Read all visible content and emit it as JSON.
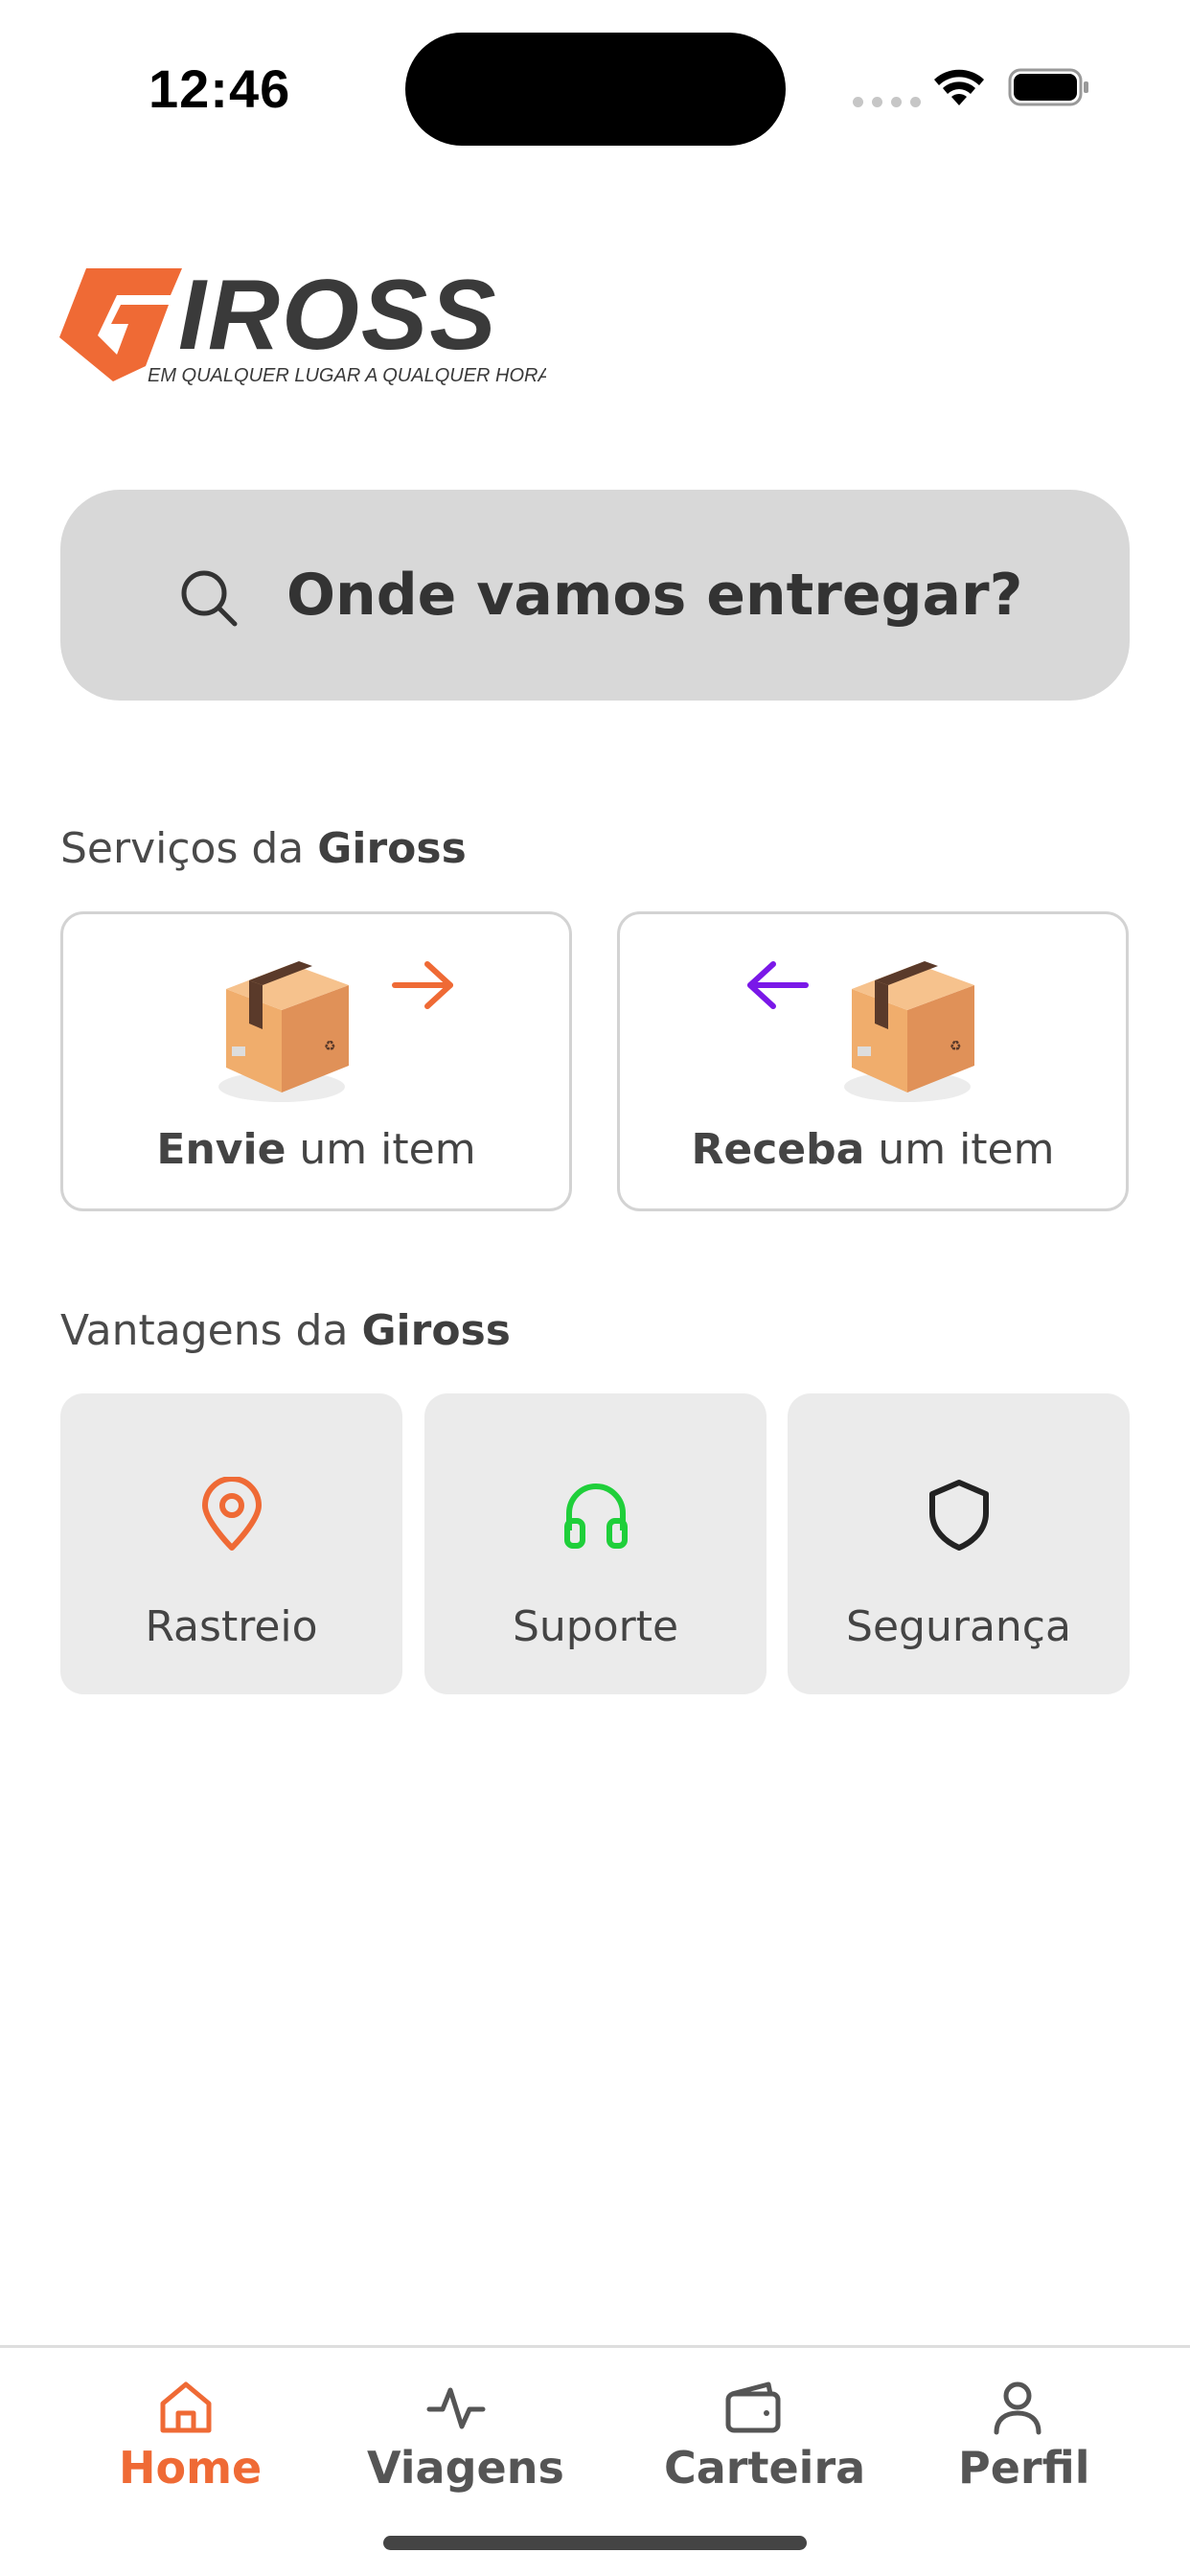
{
  "status_bar": {
    "time": "12:46"
  },
  "brand": {
    "name": "GIROSS",
    "tagline": "EM QUALQUER LUGAR A QUALQUER HORA",
    "accent": "#ef6a35",
    "dark": "#3a3a3a"
  },
  "search": {
    "placeholder": "Onde vamos entregar?"
  },
  "services": {
    "title_prefix": "Serviços da ",
    "title_brand": "Giross",
    "items": [
      {
        "bold": "Envie",
        "rest": " um item",
        "arrow_color": "#ef6a35",
        "icon": "arrow-right-icon"
      },
      {
        "bold": "Receba",
        "rest": " um item",
        "arrow_color": "#7a18e8",
        "icon": "arrow-left-icon"
      }
    ]
  },
  "advantages": {
    "title_prefix": "Vantagens da ",
    "title_brand": "Giross",
    "items": [
      {
        "label": "Rastreio",
        "icon": "map-pin-icon",
        "color": "#ef6a35"
      },
      {
        "label": "Suporte",
        "icon": "headphones-icon",
        "color": "#1fcf3a"
      },
      {
        "label": "Segurança",
        "icon": "shield-icon",
        "color": "#222222"
      }
    ]
  },
  "tabbar": {
    "active_color": "#ef6a35",
    "items": [
      {
        "label": "Home",
        "icon": "home-icon",
        "active": true
      },
      {
        "label": "Viagens",
        "icon": "activity-icon",
        "active": false
      },
      {
        "label": "Carteira",
        "icon": "wallet-icon",
        "active": false
      },
      {
        "label": "Perfil",
        "icon": "user-icon",
        "active": false
      }
    ]
  }
}
